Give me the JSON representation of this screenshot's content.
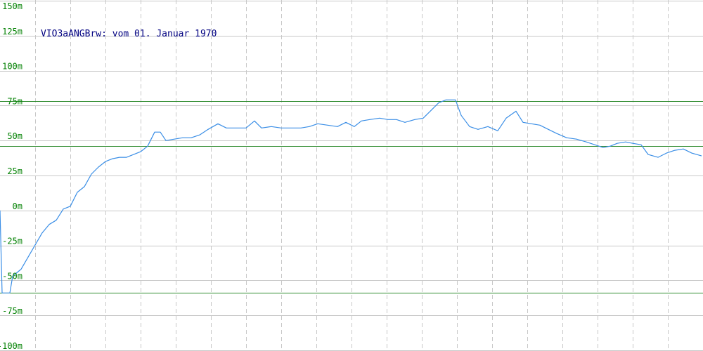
{
  "chart_data": {
    "type": "line",
    "title": "VIO3aANGBrw: vom 01. Januar 1970",
    "xlabel": "",
    "ylabel": "",
    "ylim": [
      -100,
      150
    ],
    "yticks": [
      150,
      125,
      100,
      75,
      50,
      25,
      0,
      -25,
      -50,
      -75,
      -100
    ],
    "ytick_labels": [
      "150m",
      "125m",
      "100m",
      "75m",
      "50m",
      "25m",
      "0m",
      "-25m",
      "-50m",
      "-75m",
      "-100m"
    ],
    "grid": true,
    "x_gridlines": 20,
    "x_range": [
      0,
      1000
    ],
    "reference_lines": [
      78,
      46,
      -59
    ],
    "colors": {
      "line": "#3a8ee6",
      "reference": "#2e8b2e",
      "tick_label": "#008000",
      "title": "#000080",
      "grid": "#c8c8c8"
    },
    "series": [
      {
        "values": [
          [
            0,
            0
          ],
          [
            3,
            -59
          ],
          [
            14,
            -59
          ],
          [
            18,
            -47
          ],
          [
            30,
            -42
          ],
          [
            45,
            -29
          ],
          [
            60,
            -16
          ],
          [
            70,
            -10
          ],
          [
            80,
            -7
          ],
          [
            90,
            1
          ],
          [
            100,
            3
          ],
          [
            110,
            13
          ],
          [
            120,
            17
          ],
          [
            130,
            26
          ],
          [
            140,
            31
          ],
          [
            150,
            35
          ],
          [
            160,
            37
          ],
          [
            170,
            38
          ],
          [
            180,
            38
          ],
          [
            190,
            40
          ],
          [
            200,
            42
          ],
          [
            210,
            46
          ],
          [
            220,
            56
          ],
          [
            228,
            56
          ],
          [
            236,
            50
          ],
          [
            248,
            51
          ],
          [
            260,
            52
          ],
          [
            272,
            52
          ],
          [
            284,
            54
          ],
          [
            296,
            58
          ],
          [
            310,
            62
          ],
          [
            322,
            59
          ],
          [
            336,
            59
          ],
          [
            350,
            59
          ],
          [
            362,
            64
          ],
          [
            372,
            59
          ],
          [
            386,
            60
          ],
          [
            400,
            59
          ],
          [
            414,
            59
          ],
          [
            428,
            59
          ],
          [
            440,
            60
          ],
          [
            452,
            62
          ],
          [
            466,
            61
          ],
          [
            480,
            60
          ],
          [
            492,
            63
          ],
          [
            504,
            60
          ],
          [
            514,
            64
          ],
          [
            526,
            65
          ],
          [
            540,
            66
          ],
          [
            552,
            65
          ],
          [
            564,
            65
          ],
          [
            576,
            63
          ],
          [
            590,
            65
          ],
          [
            602,
            66
          ],
          [
            614,
            72
          ],
          [
            624,
            77
          ],
          [
            634,
            79
          ],
          [
            648,
            79
          ],
          [
            656,
            68
          ],
          [
            668,
            60
          ],
          [
            680,
            58
          ],
          [
            694,
            60
          ],
          [
            708,
            57
          ],
          [
            720,
            66
          ],
          [
            734,
            71
          ],
          [
            744,
            63
          ],
          [
            756,
            62
          ],
          [
            768,
            61
          ],
          [
            780,
            58
          ],
          [
            792,
            55
          ],
          [
            806,
            52
          ],
          [
            820,
            51
          ],
          [
            834,
            49
          ],
          [
            846,
            47
          ],
          [
            858,
            45
          ],
          [
            868,
            46
          ],
          [
            878,
            48
          ],
          [
            890,
            49
          ],
          [
            900,
            48
          ],
          [
            912,
            47
          ],
          [
            922,
            40
          ],
          [
            936,
            38
          ],
          [
            948,
            41
          ],
          [
            960,
            43
          ],
          [
            972,
            44
          ],
          [
            984,
            41
          ],
          [
            998,
            39
          ]
        ]
      }
    ]
  }
}
